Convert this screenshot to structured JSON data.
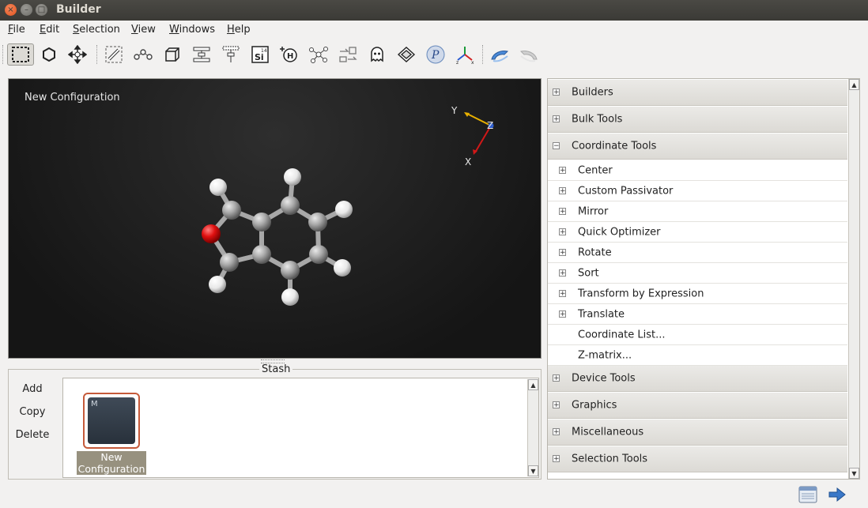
{
  "window": {
    "title": "Builder",
    "close_glyph": "×",
    "minimize_glyph": "–",
    "maximize_glyph": "□"
  },
  "menubar": {
    "file": {
      "mnemonic": "F",
      "rest": "ile"
    },
    "edit": {
      "mnemonic": "E",
      "rest": "dit"
    },
    "selection": {
      "mnemonic": "S",
      "rest": "election"
    },
    "view": {
      "mnemonic": "V",
      "rest": "iew"
    },
    "windows": {
      "mnemonic": "W",
      "rest": "indows"
    },
    "help": {
      "mnemonic": "H",
      "rest": "elp"
    }
  },
  "toolbar": {
    "active_tool": "selection-rectangle",
    "silicon_symbol": "Si",
    "silicon_number": "14",
    "hydrogen_symbol": "H",
    "axes_z": "z",
    "axes_x": "x"
  },
  "viewer": {
    "label": "New Configuration",
    "axes": {
      "x": "X",
      "y": "Y",
      "z": "Z"
    },
    "colors": {
      "carbon": "#a8a8a8",
      "hydrogen": "#f0f0f0",
      "oxygen": "#e01010",
      "x_axis": "#d01818",
      "y_axis": "#e8b000",
      "z_axis": "#3060d0"
    }
  },
  "stash": {
    "title": "Stash",
    "add_label": "Add",
    "copy_label": "Copy",
    "delete_label": "Delete",
    "items": [
      {
        "badge": "M",
        "name_line1": "New",
        "name_line2": "Configuration"
      }
    ]
  },
  "tools_panel": {
    "sections": [
      {
        "label": "Builders",
        "expanded": false
      },
      {
        "label": "Bulk Tools",
        "expanded": false
      },
      {
        "label": "Coordinate Tools",
        "expanded": true,
        "children": [
          {
            "label": "Center",
            "expandable": true
          },
          {
            "label": "Custom Passivator",
            "expandable": true
          },
          {
            "label": "Mirror",
            "expandable": true
          },
          {
            "label": "Quick Optimizer",
            "expandable": true
          },
          {
            "label": "Rotate",
            "expandable": true
          },
          {
            "label": "Sort",
            "expandable": true
          },
          {
            "label": "Transform by Expression",
            "expandable": true
          },
          {
            "label": "Translate",
            "expandable": true
          },
          {
            "label": "Coordinate List...",
            "expandable": false
          },
          {
            "label": "Z-matrix...",
            "expandable": false
          }
        ]
      },
      {
        "label": "Device Tools",
        "expanded": false
      },
      {
        "label": "Graphics",
        "expanded": false
      },
      {
        "label": "Miscellaneous",
        "expanded": false
      },
      {
        "label": "Selection Tools",
        "expanded": false
      }
    ],
    "expand_glyph": "+",
    "collapse_glyph": "−"
  }
}
